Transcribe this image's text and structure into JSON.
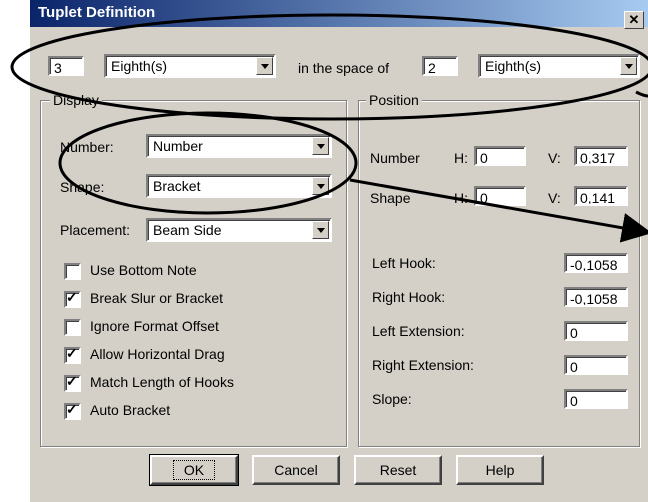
{
  "window": {
    "title": "Tuplet Definition",
    "close_glyph": "✕"
  },
  "top_row": {
    "count_value": "3",
    "count_unit": "Eighth(s)",
    "space_label": "in the space of",
    "space_value": "2",
    "space_unit": "Eighth(s)"
  },
  "display": {
    "title": "Display",
    "number_label": "Number:",
    "number_value": "Number",
    "shape_label": "Shape:",
    "shape_value": "Bracket",
    "placement_label": "Placement:",
    "placement_value": "Beam Side",
    "options": [
      {
        "label": "Use Bottom Note",
        "checked": false
      },
      {
        "label": "Break Slur or Bracket",
        "checked": true
      },
      {
        "label": "Ignore Format Offset",
        "checked": false
      },
      {
        "label": "Allow Horizontal Drag",
        "checked": true
      },
      {
        "label": "Match Length of Hooks",
        "checked": true
      },
      {
        "label": "Auto Bracket",
        "checked": true
      }
    ]
  },
  "position": {
    "title": "Position",
    "number_label": "Number",
    "number_h_label": "H:",
    "number_h": "0",
    "number_v_label": "V:",
    "number_v": "0,317",
    "shape_label": "Shape",
    "shape_h_label": "H:",
    "shape_h": "0",
    "shape_v_label": "V:",
    "shape_v": "0,141",
    "fields": [
      {
        "label": "Left Hook:",
        "value": "-0,1058"
      },
      {
        "label": "Right Hook:",
        "value": "-0,1058"
      },
      {
        "label": "Left Extension:",
        "value": "0"
      },
      {
        "label": "Right Extension:",
        "value": "0"
      },
      {
        "label": "Slope:",
        "value": "0"
      }
    ]
  },
  "buttons": {
    "ok": "OK",
    "cancel": "Cancel",
    "reset": "Reset",
    "help": "Help"
  },
  "annotation_color": "#000000"
}
